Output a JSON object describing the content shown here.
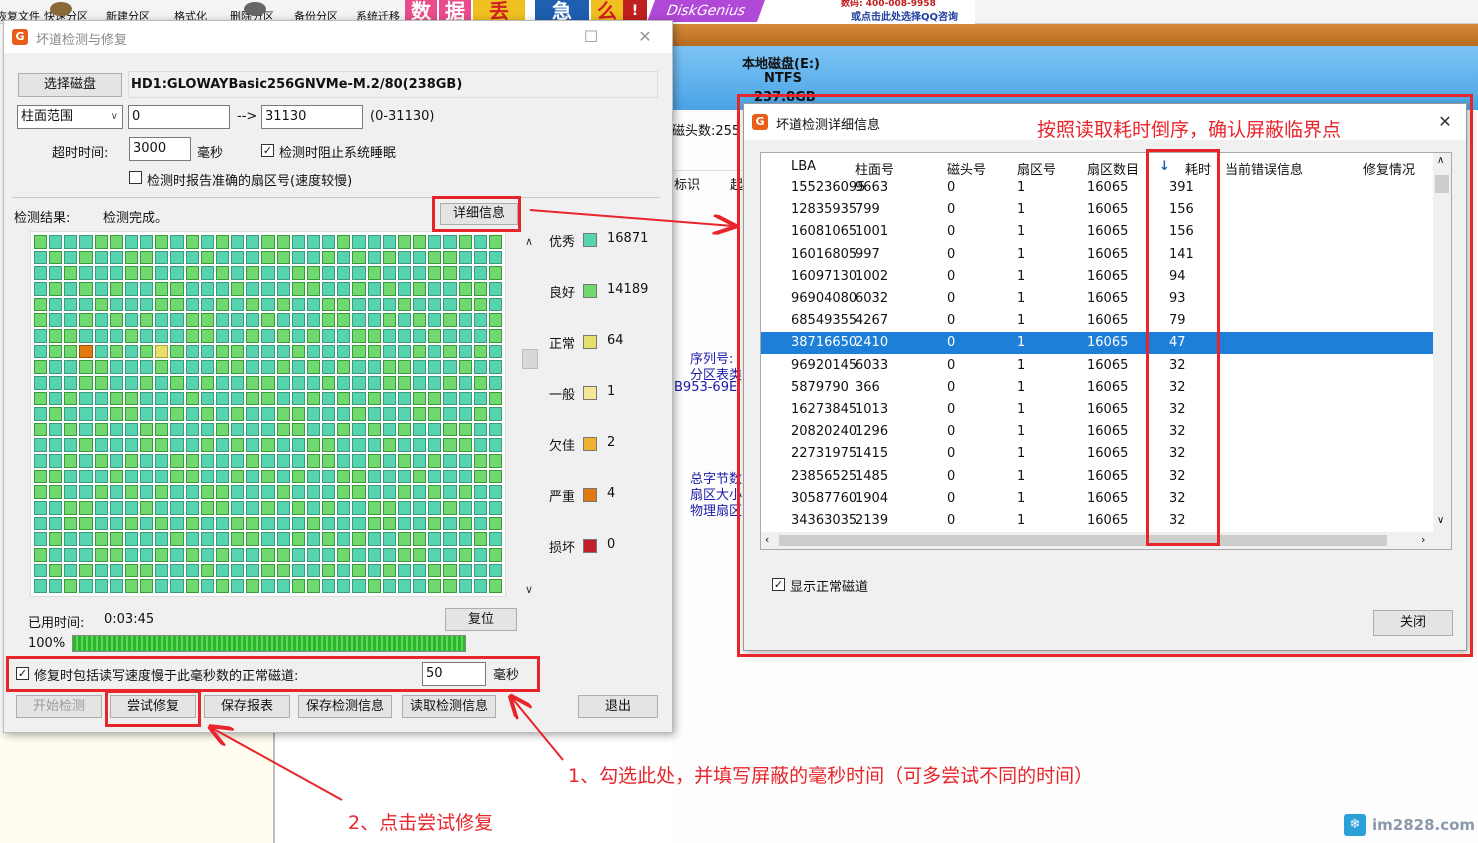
{
  "toolbar": {
    "items": [
      "恢复文件",
      "快速分区",
      "新建分区",
      "格式化",
      "删除分区",
      "备份分区",
      "系统迁移"
    ]
  },
  "banner": {
    "blocks": [
      "数",
      "据",
      "丢",
      "急",
      "么"
    ],
    "brand": "DiskGenius",
    "contact_line1": "数码: 400-008-9958",
    "contact_line2": "或点击此处选择QQ咨询"
  },
  "disk_banner": {
    "name": "本地磁盘(E:)",
    "fs": "NTFS",
    "size": "237.8GB"
  },
  "bg_labels": {
    "heads": "磁头数:255",
    "mark": "标识",
    "mark2": "起",
    "serial": "序列号:",
    "partition_table": "分区表类",
    "guid": "B953-69E",
    "total_bytes": "总字节数",
    "sector_size": "扇区大小",
    "physical_sector": "物理扇区"
  },
  "dialog1": {
    "title": "坏道检测与修复",
    "select_disk_button": "选择磁盘",
    "disk_name": "HD1:GLOWAYBasic256GNVMe-M.2/80(238GB)",
    "range_type": "柱面范围",
    "range_from": "0",
    "range_arrow": "-->",
    "range_to": "31130",
    "range_hint": "(0-31130)",
    "timeout_label": "超时时间:",
    "timeout_value": "3000",
    "timeout_unit": "毫秒",
    "prevent_sleep_label": "检测时阻止系统睡眠",
    "prevent_sleep_checked": "✓",
    "report_sector_label": "检测时报告准确的扇区号(速度较慢)",
    "result_label": "检测结果:",
    "result_value": "检测完成。",
    "detail_button": "详细信息",
    "legend": [
      {
        "label": "优秀",
        "value": "16871",
        "color": "#56d4b0"
      },
      {
        "label": "良好",
        "value": "14189",
        "color": "#6fd86f"
      },
      {
        "label": "正常",
        "value": "64",
        "color": "#e6e06a"
      },
      {
        "label": "一般",
        "value": "1",
        "color": "#f5e79a"
      },
      {
        "label": "欠佳",
        "value": "2",
        "color": "#f0b030"
      },
      {
        "label": "严重",
        "value": "4",
        "color": "#e07a10"
      },
      {
        "label": "损坏",
        "value": "0",
        "color": "#c0202a"
      }
    ],
    "elapsed_label": "已用时间:",
    "elapsed_value": "0:03:45",
    "reset_button": "复位",
    "progress_label": "100%",
    "progress_fraction": 1.0,
    "repair_option_label": "修复时包括读写速度慢于此毫秒数的正常磁道:",
    "repair_option_checked": "✓",
    "repair_ms_value": "50",
    "repair_ms_unit": "毫秒",
    "buttons": {
      "start": "开始检测",
      "try_repair": "尝试修复",
      "save_report": "保存报表",
      "save_info": "保存检测信息",
      "read_info": "读取检测信息",
      "exit": "退出"
    }
  },
  "dialog2": {
    "title": "坏道检测详细信息",
    "columns": [
      "LBA",
      "柱面号",
      "磁头号",
      "扇区号",
      "扇区数目",
      "耗时",
      "当前错误信息",
      "修复情况"
    ],
    "sort_icon": "↓",
    "rows": [
      [
        "155236095",
        "9663",
        "0",
        "1",
        "16065",
        "391"
      ],
      [
        "12835935",
        "799",
        "0",
        "1",
        "16065",
        "156"
      ],
      [
        "16081065",
        "1001",
        "0",
        "1",
        "16065",
        "156"
      ],
      [
        "16016805",
        "997",
        "0",
        "1",
        "16065",
        "141"
      ],
      [
        "16097130",
        "1002",
        "0",
        "1",
        "16065",
        "94"
      ],
      [
        "96904080",
        "6032",
        "0",
        "1",
        "16065",
        "93"
      ],
      [
        "68549355",
        "4267",
        "0",
        "1",
        "16065",
        "79"
      ],
      [
        "38716650",
        "2410",
        "0",
        "1",
        "16065",
        "47"
      ],
      [
        "96920145",
        "6033",
        "0",
        "1",
        "16065",
        "32"
      ],
      [
        "5879790",
        "366",
        "0",
        "1",
        "16065",
        "32"
      ],
      [
        "16273845",
        "1013",
        "0",
        "1",
        "16065",
        "32"
      ],
      [
        "20820240",
        "1296",
        "0",
        "1",
        "16065",
        "32"
      ],
      [
        "22731975",
        "1415",
        "0",
        "1",
        "16065",
        "32"
      ],
      [
        "23856525",
        "1485",
        "0",
        "1",
        "16065",
        "32"
      ],
      [
        "30587760",
        "1904",
        "0",
        "1",
        "16065",
        "32"
      ],
      [
        "34363035",
        "2139",
        "0",
        "1",
        "16065",
        "32"
      ]
    ],
    "selected_row": 7,
    "show_normal_label": "显示正常磁道",
    "show_normal_checked": "✓",
    "close_button": "关闭"
  },
  "annotations": {
    "top": "按照读取耗时倒序，确认屏蔽临界点",
    "step1": "1、勾选此处，并填写屏蔽的毫秒时间（可多尝试不同的时间）",
    "step2": "2、点击尝试修复"
  },
  "watermark": "im2828.com"
}
